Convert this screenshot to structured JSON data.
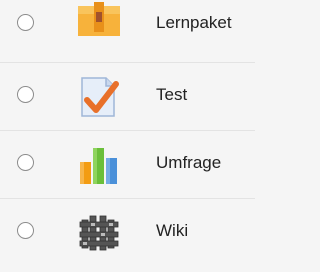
{
  "activities": [
    {
      "label": "Lernpaket",
      "icon": "package-icon"
    },
    {
      "label": "Test",
      "icon": "quiz-icon"
    },
    {
      "label": "Umfrage",
      "icon": "survey-icon"
    },
    {
      "label": "Wiki",
      "icon": "wiki-icon"
    }
  ],
  "colors": {
    "package": "#f5a623",
    "quiz_check": "#e8702a",
    "survey_green": "#6bbf3a",
    "survey_orange": "#f39c12",
    "survey_blue": "#4a90d9"
  }
}
